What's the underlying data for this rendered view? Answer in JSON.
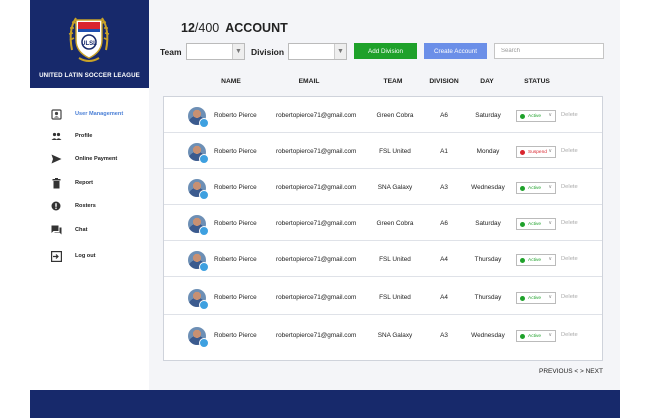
{
  "brand": {
    "name": "UNITED LATIN SOCCER LEAGUE",
    "logo_text": "ULSL",
    "accent_color": "#17296b"
  },
  "sidebar": {
    "items": [
      {
        "label": "User Management",
        "icon": "user-shield-icon",
        "active": true
      },
      {
        "label": "Profile",
        "icon": "people-icon",
        "active": false
      },
      {
        "label": "Online Payment",
        "icon": "send-icon",
        "active": false
      },
      {
        "label": "Report",
        "icon": "trash-icon",
        "active": false
      },
      {
        "label": "Rosters",
        "icon": "alert-circle-icon",
        "active": false
      },
      {
        "label": "Chat",
        "icon": "chat-icon",
        "active": false
      },
      {
        "label": "Log out",
        "icon": "logout-icon",
        "active": false
      }
    ]
  },
  "header": {
    "count": "12",
    "total": "/400",
    "title": "ACCOUNT"
  },
  "filters": {
    "team_label": "Team",
    "team_value": "",
    "division_label": "Division",
    "division_value": "",
    "add_division_label": "Add Division",
    "create_account_label": "Create Account",
    "search_placeholder": "Search",
    "add_color": "#1ea12a",
    "create_color": "#6b8fe8"
  },
  "table": {
    "columns": [
      "NAME",
      "EMAIL",
      "TEAM",
      "DIVISION",
      "DAY",
      "STATUS"
    ],
    "delete_label": "Delete",
    "rows": [
      {
        "name": "Roberto Pierce",
        "email": "robertopierce71@gmail.com",
        "team": "Green Cobra",
        "division": "A6",
        "day": "Saturday",
        "status": "Active",
        "status_color": "#1ea12a"
      },
      {
        "name": "Roberto Pierce",
        "email": "robertopierce71@gmail.com",
        "team": "FSL United",
        "division": "A1",
        "day": "Monday",
        "status": "Suspend",
        "status_color": "#d9252e"
      },
      {
        "name": "Roberto Pierce",
        "email": "robertopierce71@gmail.com",
        "team": "SNA Galaxy",
        "division": "A3",
        "day": "Wednesday",
        "status": "Active",
        "status_color": "#1ea12a"
      },
      {
        "name": "Roberto Pierce",
        "email": "robertopierce71@gmail.com",
        "team": "Green Cobra",
        "division": "A6",
        "day": "Saturday",
        "status": "Active",
        "status_color": "#1ea12a"
      },
      {
        "name": "Roberto Pierce",
        "email": "robertopierce71@gmail.com",
        "team": "FSL United",
        "division": "A4",
        "day": "Thursday",
        "status": "Active",
        "status_color": "#1ea12a"
      },
      {
        "name": "Roberto Pierce",
        "email": "robertopierce71@gmail.com",
        "team": "FSL United",
        "division": "A4",
        "day": "Thursday",
        "status": "Active",
        "status_color": "#1ea12a"
      },
      {
        "name": "Roberto Pierce",
        "email": "robertopierce71@gmail.com",
        "team": "SNA Galaxy",
        "division": "A3",
        "day": "Wednesday",
        "status": "Active",
        "status_color": "#1ea12a"
      }
    ]
  },
  "pagination": {
    "label": "PREVIOUS < > NEXT"
  }
}
